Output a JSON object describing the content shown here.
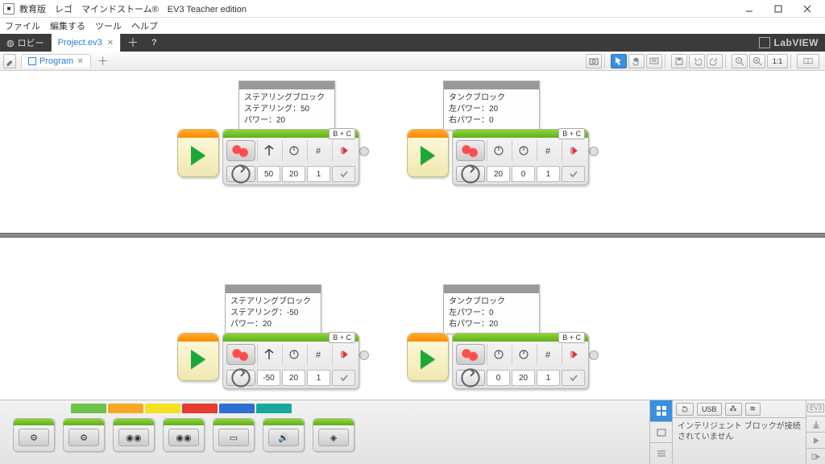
{
  "window": {
    "title": "教育版　レゴ　マインドストーム®　EV3 Teacher edition"
  },
  "menu": {
    "file": "ファイル",
    "edit": "編集する",
    "tools": "ツール",
    "help": "ヘルプ"
  },
  "tabs": {
    "lobby": "ロビー",
    "project": "Project.ev3"
  },
  "brand": "LabVIEW",
  "program_tab": "Program",
  "toolbar_1_1": "1:1",
  "comments": {
    "c1": {
      "title": "ステアリングブロック",
      "l1": "ステアリング：50",
      "l2": "パワー：20"
    },
    "c2": {
      "title": "タンクブロック",
      "l1": "左パワー：20",
      "l2": "右パワー：0"
    },
    "c3": {
      "title": "ステアリングブロック",
      "l1": "ステアリング：-50",
      "l2": "パワー：20"
    },
    "c4": {
      "title": "タンクブロック",
      "l1": "左パワー：0",
      "l2": "右パワー：20"
    }
  },
  "ports": {
    "bc": "B + C"
  },
  "block1": {
    "v1": "50",
    "v2": "20",
    "v3": "1"
  },
  "block2": {
    "v1": "20",
    "v2": "0",
    "v3": "1"
  },
  "block3": {
    "v1": "-50",
    "v2": "20",
    "v3": "1"
  },
  "block4": {
    "v1": "0",
    "v2": "20",
    "v3": "1"
  },
  "palette_colors": [
    "#6cc24a",
    "#f7a823",
    "#f6e11e",
    "#e53c2e",
    "#2e6fd1",
    "#14a99a"
  ],
  "status": {
    "usb": "USB",
    "ev3": "EV3",
    "msg": "インテリジェント ブロックが接続されていません"
  }
}
